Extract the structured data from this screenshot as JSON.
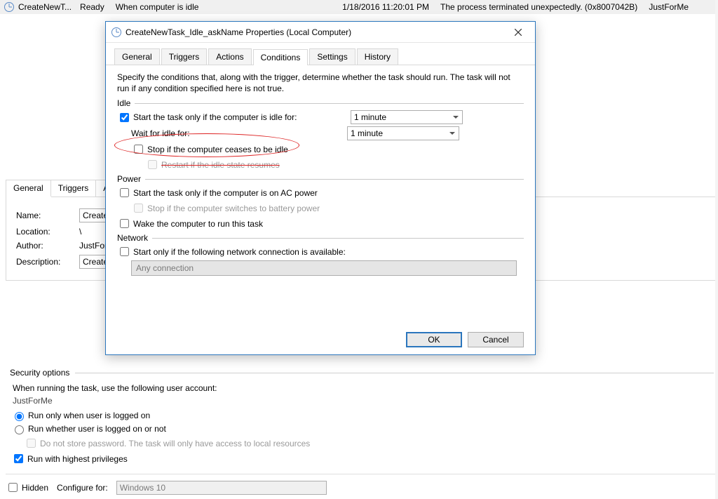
{
  "bgRow": {
    "name": "CreateNewT...",
    "status": "Ready",
    "trigger": "When computer is idle",
    "lastRun": "1/18/2016 11:20:01 PM",
    "lastResult": "The process terminated unexpectedly. (0x8007042B)",
    "author": "JustForMe"
  },
  "bgTabs": [
    "General",
    "Triggers",
    "Actions"
  ],
  "bgGeneral": {
    "nameLbl": "Name:",
    "name": "CreateNe",
    "locLbl": "Location:",
    "loc": "\\",
    "authLbl": "Author:",
    "auth": "JustForM",
    "descLbl": "Description:",
    "desc": "CreateN"
  },
  "dialog": {
    "title": "CreateNewTask_Idle_askName Properties (Local Computer)",
    "tabs": [
      "General",
      "Triggers",
      "Actions",
      "Conditions",
      "Settings",
      "History"
    ],
    "description": "Specify the conditions that, along with the trigger, determine whether the task should run.  The task will not run  if any condition specified here is not true.",
    "idle": {
      "title": "Idle",
      "startLabel": "Start the task only if the computer is idle for:",
      "startDur": "1 minute",
      "waitLabel": "Wait for idle for:",
      "waitDur": "1 minute",
      "stopLabel": "Stop if the computer ceases to be idle",
      "restartLabel": "Restart if the idle state resumes"
    },
    "power": {
      "title": "Power",
      "acLabel": "Start the task only if the computer is on AC power",
      "batLabel": "Stop if the computer switches to battery power",
      "wakeLabel": "Wake the computer to run this task"
    },
    "network": {
      "title": "Network",
      "onlyLabel": "Start only if the following network connection is available:",
      "conn": "Any connection"
    },
    "ok": "OK",
    "cancel": "Cancel"
  },
  "security": {
    "title": "Security options",
    "runLine": "When running the task, use the following user account:",
    "account": "JustForMe",
    "runLogged": "Run only when user is logged on",
    "runNot": "Run whether user is logged on or not",
    "noPwd": "Do not store password.  The task will only have access to local resources",
    "highest": "Run with highest privileges"
  },
  "bottom": {
    "hidden": "Hidden",
    "cfgLbl": "Configure for:",
    "cfg": "Windows 10"
  }
}
